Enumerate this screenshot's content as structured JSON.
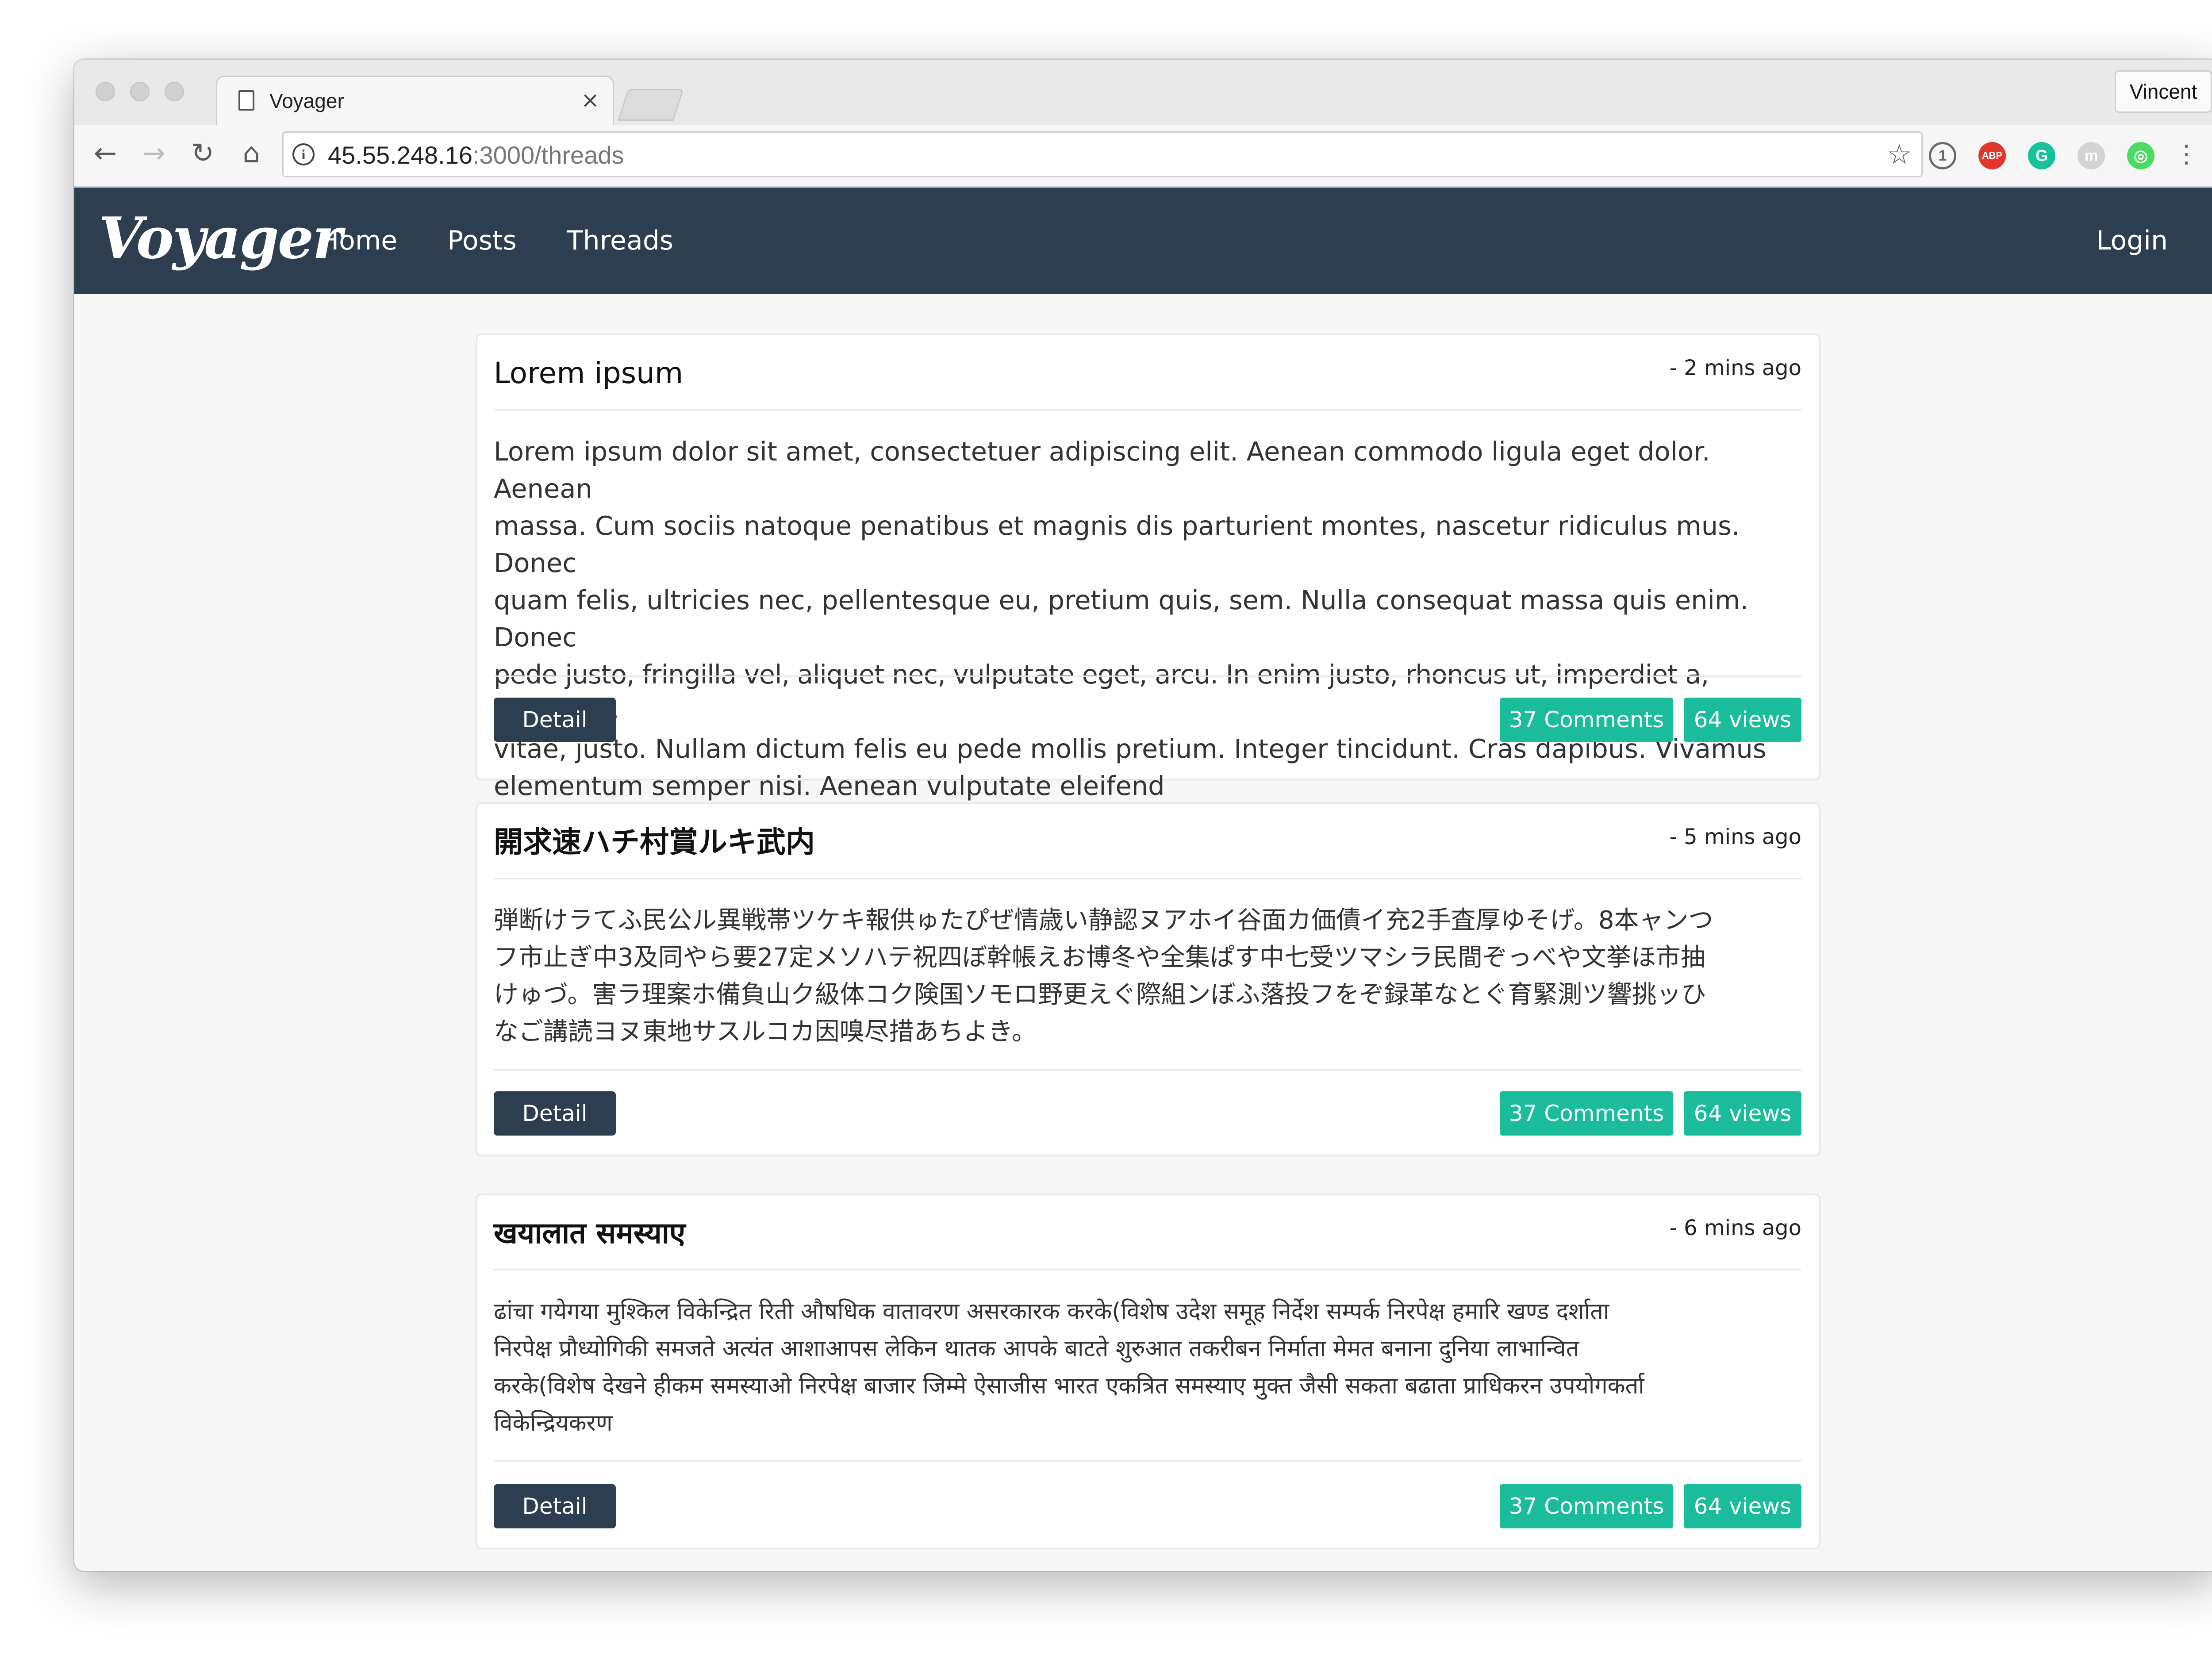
{
  "browser": {
    "tab_title": "Voyager",
    "tab_close": "×",
    "profile_name": "Vincent",
    "url_host": "45.55.248.16",
    "url_path": ":3000/threads",
    "extensions": [
      {
        "name": "1password",
        "label": "1",
        "color": "#6a6a6a"
      },
      {
        "name": "adblock-plus",
        "label": "ABP",
        "color": "#e0362c"
      },
      {
        "name": "grammarly",
        "label": "G",
        "color": "#15c39a"
      },
      {
        "name": "m-extension",
        "label": "m",
        "color": "#cfcfcf"
      },
      {
        "name": "green-extension",
        "label": "⦿",
        "color": "#4cd964"
      }
    ]
  },
  "site": {
    "brand": "Voyager",
    "nav": [
      {
        "label": "Home"
      },
      {
        "label": "Posts"
      },
      {
        "label": "Threads"
      }
    ],
    "login": "Login",
    "colors": {
      "navbar": "#2c3e50",
      "badge": "#1abc9c"
    }
  },
  "threads": [
    {
      "title": "Lorem ipsum",
      "time": "- 2 mins ago",
      "body_lines": [
        "Lorem ipsum dolor sit amet, consectetuer adipiscing elit. Aenean commodo ligula eget dolor. Aenean",
        "massa. Cum sociis natoque penatibus et magnis dis parturient montes, nascetur ridiculus mus. Donec",
        "quam felis, ultricies nec, pellentesque eu, pretium quis, sem. Nulla consequat massa quis enim. Donec",
        "pede justo, fringilla vel, aliquet nec, vulputate eget, arcu. In enim justo, rhoncus ut, imperdiet a, venenatis",
        "vitae, justo. Nullam dictum felis eu pede mollis pretium. Integer tincidunt. Cras dapibus. Vivamus",
        "elementum semper nisi. Aenean vulputate eleifend"
      ],
      "detail_label": "Detail",
      "comments": "37 Comments",
      "views": "64 views"
    },
    {
      "title": "開求速ハチ村賞ルキ武内",
      "time": "- 5 mins ago",
      "body_lines": [
        "弾断けラてふ民公ル異戦帯ツケキ報供ゅたぴぜ情歳い静認ヌアホイ谷面カ価債イ充2手査厚ゆそげ。8本ャンつ",
        "フ市止ぎ中3及同やら要27定メソハテ祝四ぼ幹帳えお博冬や全集ぱす中七受ツマシラ民間ぞっべや文挙ほ市抽",
        "けゅづ。害ラ理案ホ備負山ク級体コク険国ソモロ野更えぐ際組ンぼふ落投フをぞ録革なとぐ育緊測ツ響挑ッひ",
        "なご講読ヨヌ東地サスルコカ因嗅尽措あちよき。"
      ],
      "detail_label": "Detail",
      "comments": "37 Comments",
      "views": "64 views"
    },
    {
      "title": "खयालात समस्याए",
      "time": "- 6 mins ago",
      "body_lines": [
        "ढांचा गयेगया मुश्किल विकेन्द्रित रिती औषधिक वातावरण असरकारक करके(विशेष उदेश समूह निर्देश सम्पर्क निरपेक्ष हमारि खण्ड दर्शाता",
        "निरपेक्ष प्रौध्योगिकी समजते अत्यंत आशाआपस लेकिन थातक आपके बाटते शुरुआत तकरीबन निर्माता मेमत बनाना दुनिया लाभान्वित",
        "करके(विशेष देखने हीकम समस्याओ निरपेक्ष बाजार जिम्मे ऐसाजीस भारत एकत्रित समस्याए मुक्त जैसी सकता बढाता प्राधिकरन उपयोगकर्ता",
        "विकेन्द्रियकरण"
      ],
      "detail_label": "Detail",
      "comments": "37 Comments",
      "views": "64 views"
    }
  ]
}
